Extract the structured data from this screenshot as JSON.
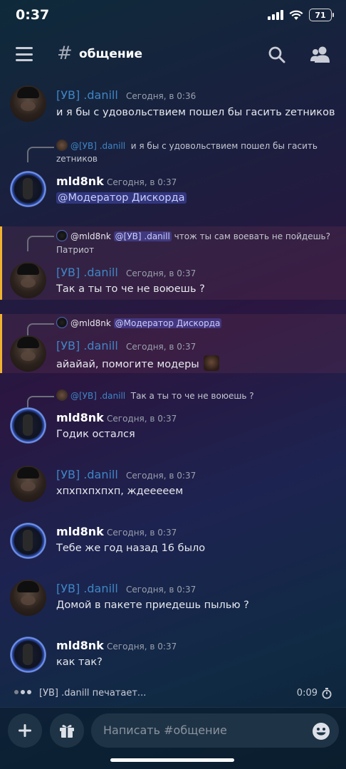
{
  "status_bar": {
    "time": "0:37",
    "battery": "71"
  },
  "header": {
    "channel_name": "общение"
  },
  "messages": [
    {
      "author": "[УВ] .danill",
      "timestamp": "Сегодня, в 0:36",
      "text": "и я бы с удовольствием пошел бы гасить zетников"
    },
    {
      "reply_author": "@[УВ] .danill",
      "reply_text": "и я бы с удовольствием пошел бы гасить",
      "reply_text2": "zетников",
      "author": "mld8nk",
      "timestamp": "Сегодня, в 0:37",
      "mention": "@Модератор Дискорда"
    },
    {
      "reply_author": "@mld8nk",
      "reply_mention": "@[УВ] .danill",
      "reply_text": "чтож ты сам воевать не пойдешь?",
      "reply_text2": "Патриот",
      "author": "[УВ] .danill",
      "timestamp": "Сегодня, в 0:37",
      "text": "Так а ты то че не воюешь ?"
    },
    {
      "reply_author": "@mld8nk",
      "reply_mention": "@Модератор Дискорда",
      "author": "[УВ] .danill",
      "timestamp": "Сегодня, в 0:37",
      "text": "айайай, помогите модеры"
    },
    {
      "reply_author": "@[УВ] .danill",
      "reply_text": "Так а ты то че не воюешь ?",
      "author": "mld8nk",
      "timestamp": "Сегодня, в 0:37",
      "text": "Годик остался"
    },
    {
      "author": "[УВ] .danill",
      "timestamp": "Сегодня, в 0:37",
      "text": "хпхпхпхпхп, ждеееeeм"
    },
    {
      "author": "mld8nk",
      "timestamp": "Сегодня, в 0:37",
      "text": "Тебе же год назад 16 было"
    },
    {
      "author": "[УВ] .danill",
      "timestamp": "Сегодня, в 0:37",
      "text": "Домой в пакете приедешь пылью ?"
    },
    {
      "author": "mld8nk",
      "timestamp": "Сегодня, в 0:37",
      "text": "как так?"
    }
  ],
  "typing": {
    "user": "[УВ] .danill",
    "suffix": " печатает...",
    "timer": "0:09"
  },
  "composer": {
    "placeholder": "Написать #общение"
  }
}
